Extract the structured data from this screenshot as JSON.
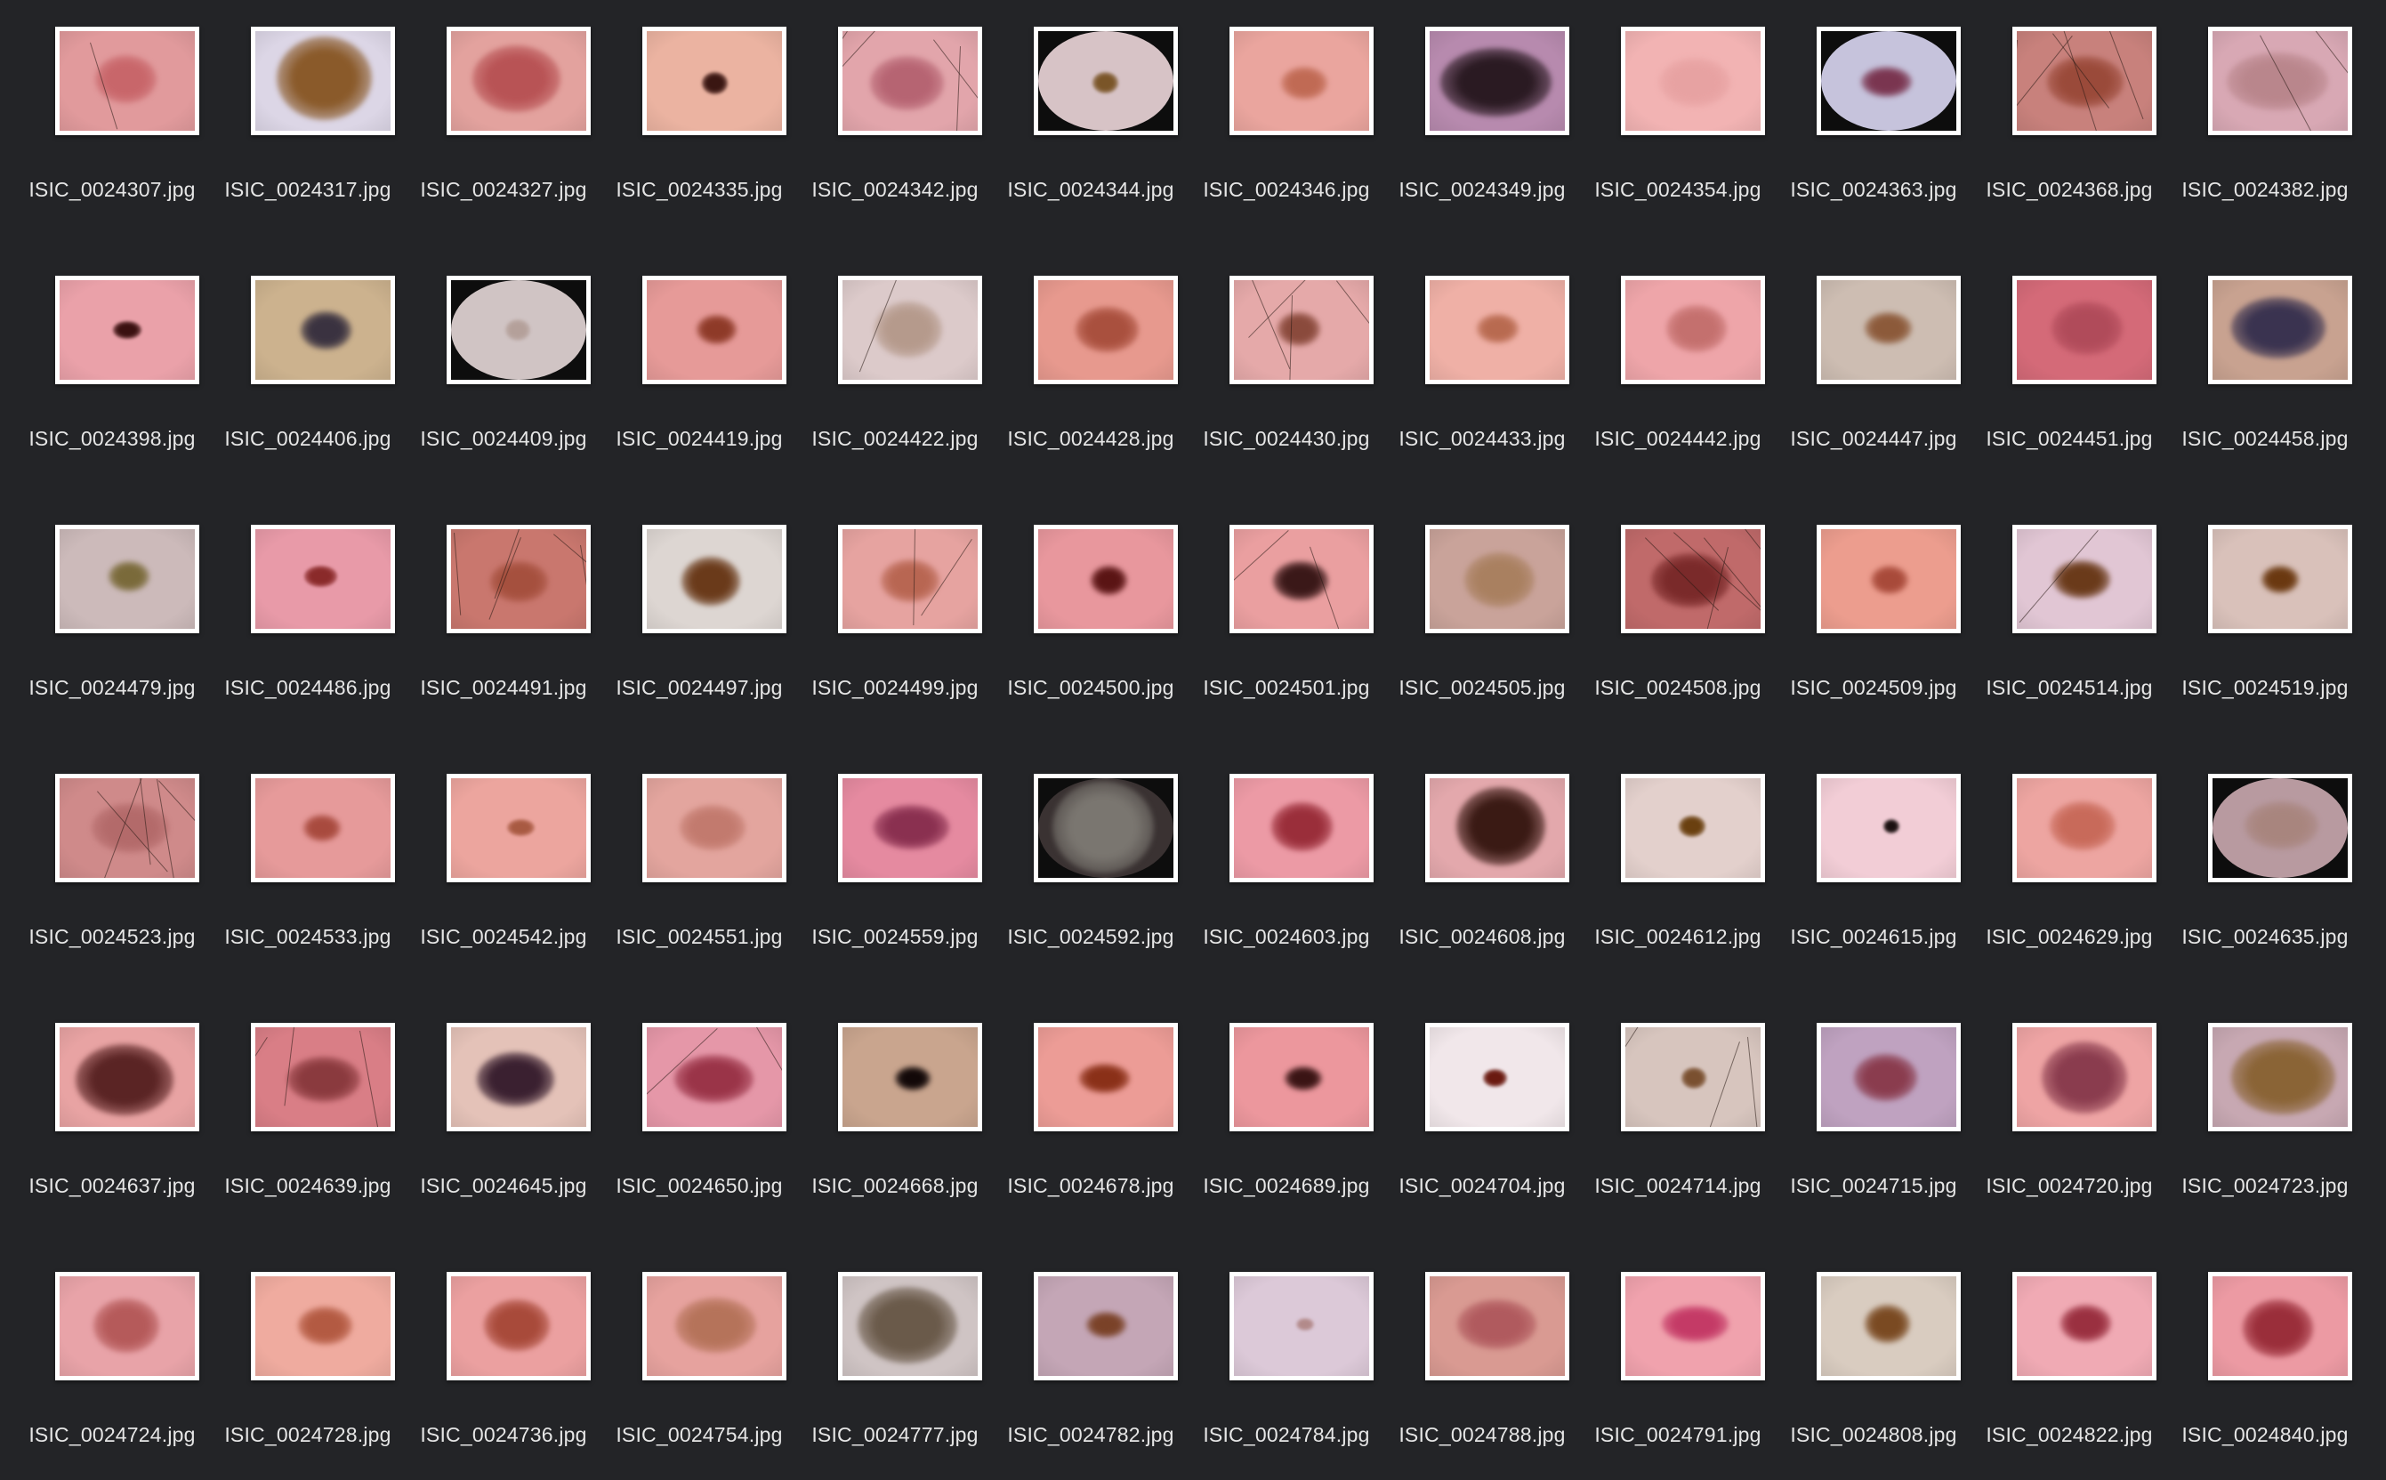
{
  "files": [
    {
      "name": "ISIC_0024307.jpg",
      "skin": "#e19a9c",
      "lesion": "#c8666a",
      "ls": 0.45,
      "hairs": 1
    },
    {
      "name": "ISIC_0024317.jpg",
      "skin": "#dcd6e6",
      "lesion": "#8a5a2a",
      "ls": 0.8,
      "hairs": 0
    },
    {
      "name": "ISIC_0024327.jpg",
      "skin": "#e3a29e",
      "lesion": "#b85355",
      "ls": 0.65,
      "hairs": 0
    },
    {
      "name": "ISIC_0024335.jpg",
      "skin": "#ebb3a1",
      "lesion": "#3a1612",
      "ls": 0.22,
      "hairs": 0
    },
    {
      "name": "ISIC_0024342.jpg",
      "skin": "#e2a5ab",
      "lesion": "#b66472",
      "ls": 0.55,
      "hairs": 4
    },
    {
      "name": "ISIC_0024344.jpg",
      "skin": "#d7c3c6",
      "lesion": "#7a5528",
      "ls": 0.22,
      "vignette": true,
      "hairs": 0
    },
    {
      "name": "ISIC_0024346.jpg",
      "skin": "#eaa59e",
      "lesion": "#c06a54",
      "ls": 0.35,
      "hairs": 0
    },
    {
      "name": "ISIC_0024349.jpg",
      "skin": "#b78aae",
      "lesion": "#2a1a22",
      "ls": 0.75,
      "hairs": 0
    },
    {
      "name": "ISIC_0024354.jpg",
      "skin": "#f2b3b3",
      "lesion": "#e7a2a2",
      "ls": 0.55,
      "hairs": 0
    },
    {
      "name": "ISIC_0024363.jpg",
      "skin": "#c6c3dc",
      "lesion": "#7a3550",
      "ls": 0.35,
      "vignette": true,
      "hairs": 0
    },
    {
      "name": "ISIC_0024368.jpg",
      "skin": "#c8817c",
      "lesion": "#9a4a3a",
      "ls": 0.6,
      "hairs": 5
    },
    {
      "name": "ISIC_0024382.jpg",
      "skin": "#d8a8b4",
      "lesion": "#b9868c",
      "ls": 0.7,
      "hairs": 2
    },
    {
      "name": "ISIC_0024398.jpg",
      "skin": "#eaa1a9",
      "lesion": "#3a1010",
      "ls": 0.22,
      "hairs": 0
    },
    {
      "name": "ISIC_0024406.jpg",
      "skin": "#ccb28e",
      "lesion": "#3a3240",
      "ls": 0.35,
      "hairs": 0
    },
    {
      "name": "ISIC_0024409.jpg",
      "skin": "#d0c4c4",
      "lesion": "#b4a09a",
      "ls": 0.2,
      "vignette": true,
      "hairs": 0
    },
    {
      "name": "ISIC_0024419.jpg",
      "skin": "#e69a98",
      "lesion": "#8e3a28",
      "ls": 0.28,
      "hairs": 0
    },
    {
      "name": "ISIC_0024422.jpg",
      "skin": "#dccaca",
      "lesion": "#b59a8c",
      "ls": 0.55,
      "hairs": 1
    },
    {
      "name": "ISIC_0024428.jpg",
      "skin": "#e7998e",
      "lesion": "#a9503e",
      "ls": 0.45,
      "hairs": 0
    },
    {
      "name": "ISIC_0024430.jpg",
      "skin": "#e5a9a9",
      "lesion": "#8a4a3c",
      "ls": 0.35,
      "hairs": 4
    },
    {
      "name": "ISIC_0024433.jpg",
      "skin": "#efb0a6",
      "lesion": "#b86a50",
      "ls": 0.3,
      "hairs": 0
    },
    {
      "name": "ISIC_0024442.jpg",
      "skin": "#eea5a9",
      "lesion": "#c4706e",
      "ls": 0.5,
      "hairs": 0
    },
    {
      "name": "ISIC_0024447.jpg",
      "skin": "#cdbdb2",
      "lesion": "#8c5a3a",
      "ls": 0.35,
      "hairs": 0
    },
    {
      "name": "ISIC_0024451.jpg",
      "skin": "#d46a78",
      "lesion": "#b04b5a",
      "ls": 0.6,
      "hairs": 0
    },
    {
      "name": "ISIC_0024458.jpg",
      "skin": "#c8a290",
      "lesion": "#3a3350",
      "ls": 0.7,
      "hairs": 0
    },
    {
      "name": "ISIC_0024479.jpg",
      "skin": "#ccbaba",
      "lesion": "#7a6a3a",
      "ls": 0.35,
      "hairs": 0
    },
    {
      "name": "ISIC_0024486.jpg",
      "skin": "#e89aa8",
      "lesion": "#8a2a2a",
      "ls": 0.25,
      "hairs": 0
    },
    {
      "name": "ISIC_0024491.jpg",
      "skin": "#c9776e",
      "lesion": "#a5503e",
      "ls": 0.5,
      "hairs": 5
    },
    {
      "name": "ISIC_0024497.jpg",
      "skin": "#ddd6d2",
      "lesion": "#6a3a1a",
      "ls": 0.45,
      "hairs": 0
    },
    {
      "name": "ISIC_0024499.jpg",
      "skin": "#e6a3a0",
      "lesion": "#b86652",
      "ls": 0.4,
      "hairs": 2
    },
    {
      "name": "ISIC_0024500.jpg",
      "skin": "#e8979d",
      "lesion": "#5a1414",
      "ls": 0.28,
      "hairs": 0
    },
    {
      "name": "ISIC_0024501.jpg",
      "skin": "#ea9fa0",
      "lesion": "#3a1818",
      "ls": 0.38,
      "hairs": 2
    },
    {
      "name": "ISIC_0024505.jpg",
      "skin": "#c9a39a",
      "lesion": "#a98060",
      "ls": 0.55,
      "hairs": 0
    },
    {
      "name": "ISIC_0024508.jpg",
      "skin": "#c06a6a",
      "lesion": "#7a2a2a",
      "ls": 0.55,
      "hairs": 5
    },
    {
      "name": "ISIC_0024509.jpg",
      "skin": "#ec9d8e",
      "lesion": "#a84a3a",
      "ls": 0.3,
      "hairs": 0
    },
    {
      "name": "ISIC_0024514.jpg",
      "skin": "#e1c6d4",
      "lesion": "#6a3a1a",
      "ls": 0.4,
      "hairs": 1
    },
    {
      "name": "ISIC_0024519.jpg",
      "skin": "#d9c1ba",
      "lesion": "#6a3810",
      "ls": 0.3,
      "hairs": 0
    },
    {
      "name": "ISIC_0024523.jpg",
      "skin": "#cf8a8a",
      "lesion": "#b36a6a",
      "ls": 0.55,
      "hairs": 5
    },
    {
      "name": "ISIC_0024533.jpg",
      "skin": "#e69a9a",
      "lesion": "#a84a3e",
      "ls": 0.3,
      "hairs": 0
    },
    {
      "name": "ISIC_0024542.jpg",
      "skin": "#eca59e",
      "lesion": "#a85a42",
      "ls": 0.2,
      "hairs": 0
    },
    {
      "name": "ISIC_0024551.jpg",
      "skin": "#e3a59e",
      "lesion": "#c27a6e",
      "ls": 0.55,
      "hairs": 0
    },
    {
      "name": "ISIC_0024559.jpg",
      "skin": "#e58aa0",
      "lesion": "#8a3050",
      "ls": 0.55,
      "hairs": 0
    },
    {
      "name": "ISIC_0024592.jpg",
      "skin": "#3a3232",
      "lesion": "#7a7670",
      "ls": 0.85,
      "vignette": true,
      "hairs": 0
    },
    {
      "name": "ISIC_0024603.jpg",
      "skin": "#ec9aa5",
      "lesion": "#9a2e3a",
      "ls": 0.45,
      "hairs": 0
    },
    {
      "name": "ISIC_0024608.jpg",
      "skin": "#e3a8ac",
      "lesion": "#3a1a14",
      "ls": 0.75,
      "hairs": 0
    },
    {
      "name": "ISIC_0024612.jpg",
      "skin": "#e3d0cc",
      "lesion": "#6a4010",
      "ls": 0.2,
      "hairs": 0
    },
    {
      "name": "ISIC_0024615.jpg",
      "skin": "#f2cdd6",
      "lesion": "#1a1010",
      "ls": 0.14,
      "hairs": 0
    },
    {
      "name": "ISIC_0024629.jpg",
      "skin": "#eda5a1",
      "lesion": "#c86a5a",
      "ls": 0.5,
      "hairs": 0
    },
    {
      "name": "ISIC_0024635.jpg",
      "skin": "#b89aa0",
      "lesion": "#a8857e",
      "ls": 0.5,
      "vignette": true,
      "hairs": 0
    },
    {
      "name": "ISIC_0024637.jpg",
      "skin": "#e8a3a3",
      "lesion": "#5a2424",
      "ls": 0.75,
      "hairs": 0
    },
    {
      "name": "ISIC_0024639.jpg",
      "skin": "#d97e86",
      "lesion": "#8a3a3e",
      "ls": 0.5,
      "hairs": 3
    },
    {
      "name": "ISIC_0024645.jpg",
      "skin": "#e4c2b8",
      "lesion": "#3a2030",
      "ls": 0.6,
      "hairs": 0
    },
    {
      "name": "ISIC_0024650.jpg",
      "skin": "#e597a8",
      "lesion": "#9a3448",
      "ls": 0.55,
      "hairs": 2
    },
    {
      "name": "ISIC_0024668.jpg",
      "skin": "#c9a58e",
      "lesion": "#120808",
      "ls": 0.28,
      "hairs": 0
    },
    {
      "name": "ISIC_0024678.jpg",
      "skin": "#ec9c96",
      "lesion": "#8a3018",
      "ls": 0.35,
      "hairs": 0
    },
    {
      "name": "ISIC_0024689.jpg",
      "skin": "#ec979d",
      "lesion": "#3a1414",
      "ls": 0.3,
      "hairs": 0
    },
    {
      "name": "ISIC_0024704.jpg",
      "skin": "#f1e7ea",
      "lesion": "#6a1a10",
      "ls": 0.17,
      "hairs": 0
    },
    {
      "name": "ISIC_0024714.jpg",
      "skin": "#d7c5be",
      "lesion": "#7a5030",
      "ls": 0.2,
      "hairs": 3
    },
    {
      "name": "ISIC_0024715.jpg",
      "skin": "#bfa2c0",
      "lesion": "#8a3c4e",
      "ls": 0.45,
      "hairs": 0
    },
    {
      "name": "ISIC_0024720.jpg",
      "skin": "#eea4a4",
      "lesion": "#8a3c4e",
      "ls": 0.7,
      "hairs": 0
    },
    {
      "name": "ISIC_0024723.jpg",
      "skin": "#c7a8b2",
      "lesion": "#8a6436",
      "ls": 0.75,
      "hairs": 0
    },
    {
      "name": "ISIC_0024724.jpg",
      "skin": "#e8a3a8",
      "lesion": "#b55a5a",
      "ls": 0.55,
      "hairs": 0
    },
    {
      "name": "ISIC_0024728.jpg",
      "skin": "#efab9f",
      "lesion": "#b35a42",
      "ls": 0.4,
      "hairs": 0
    },
    {
      "name": "ISIC_0024736.jpg",
      "skin": "#eba0a0",
      "lesion": "#a84a3a",
      "ls": 0.55,
      "hairs": 0
    },
    {
      "name": "ISIC_0024754.jpg",
      "skin": "#e6a29e",
      "lesion": "#b5735a",
      "ls": 0.6,
      "hairs": 0
    },
    {
      "name": "ISIC_0024777.jpg",
      "skin": "#cfc4c4",
      "lesion": "#6a5a4a",
      "ls": 0.85,
      "hairs": 0
    },
    {
      "name": "ISIC_0024782.jpg",
      "skin": "#c4a6b6",
      "lesion": "#7a4228",
      "ls": 0.3,
      "hairs": 0
    },
    {
      "name": "ISIC_0024784.jpg",
      "skin": "#dcc9d8",
      "lesion": "#b28a8a",
      "ls": 0.15,
      "hairs": 0
    },
    {
      "name": "ISIC_0024788.jpg",
      "skin": "#d99a92",
      "lesion": "#b05a5e",
      "ls": 0.6,
      "hairs": 0
    },
    {
      "name": "ISIC_0024791.jpg",
      "skin": "#f0a2ad",
      "lesion": "#c43a66",
      "ls": 0.45,
      "hairs": 0
    },
    {
      "name": "ISIC_0024808.jpg",
      "skin": "#d9ccc0",
      "lesion": "#7a4a22",
      "ls": 0.35,
      "hairs": 0
    },
    {
      "name": "ISIC_0024822.jpg",
      "skin": "#f0aab4",
      "lesion": "#9a3040",
      "ls": 0.35,
      "hairs": 0
    },
    {
      "name": "ISIC_0024840.jpg",
      "skin": "#ec9aa3",
      "lesion": "#9a2e3a",
      "ls": 0.55,
      "hairs": 0
    }
  ]
}
